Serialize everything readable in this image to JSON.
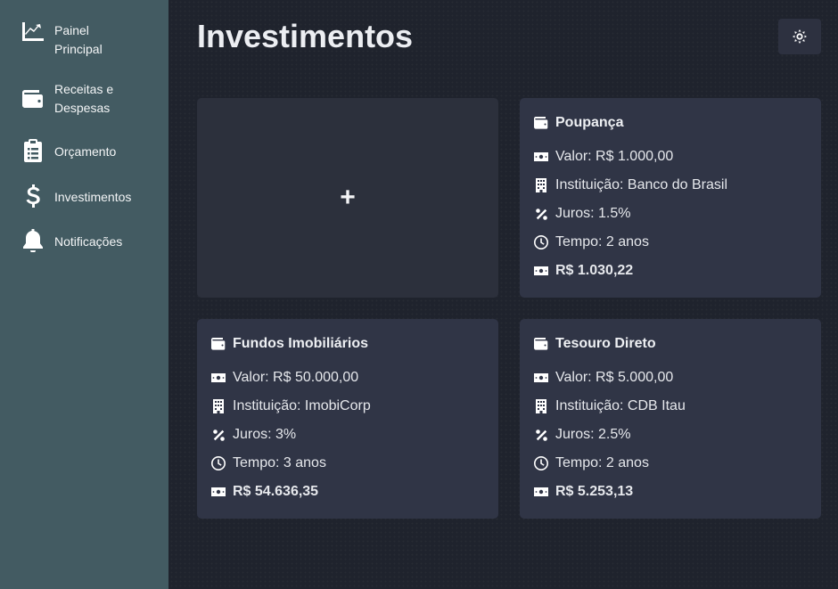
{
  "sidebar": {
    "items": [
      {
        "label": "Painel Principal",
        "icon": "chart-line-icon"
      },
      {
        "label": "Receitas e Despesas",
        "icon": "wallet-icon"
      },
      {
        "label": "Orçamento",
        "icon": "clipboard-list-icon"
      },
      {
        "label": "Investimentos",
        "icon": "dollar-icon"
      },
      {
        "label": "Notificações",
        "icon": "bell-icon"
      }
    ]
  },
  "header": {
    "title": "Investimentos",
    "theme_toggle_icon": "sun-icon"
  },
  "add_card": {
    "label": "+"
  },
  "investments": [
    {
      "name": "Poupança",
      "valor": "Valor: R$ 1.000,00",
      "instituicao": "Instituição: Banco do Brasil",
      "juros": "Juros: 1.5%",
      "tempo": "Tempo: 2 anos",
      "total": "R$ 1.030,22"
    },
    {
      "name": "Fundos Imobiliários",
      "valor": "Valor: R$ 50.000,00",
      "instituicao": "Instituição: ImobiCorp",
      "juros": "Juros: 3%",
      "tempo": "Tempo: 3 anos",
      "total": "R$ 54.636,35"
    },
    {
      "name": "Tesouro Direto",
      "valor": "Valor: R$ 5.000,00",
      "instituicao": "Instituição: CDB Itau",
      "juros": "Juros: 2.5%",
      "tempo": "Tempo: 2 anos",
      "total": "R$ 5.253,13"
    }
  ],
  "colors": {
    "sidebar_bg": "#435b62",
    "page_bg": "#1f232d",
    "card_bg": "#303546"
  }
}
